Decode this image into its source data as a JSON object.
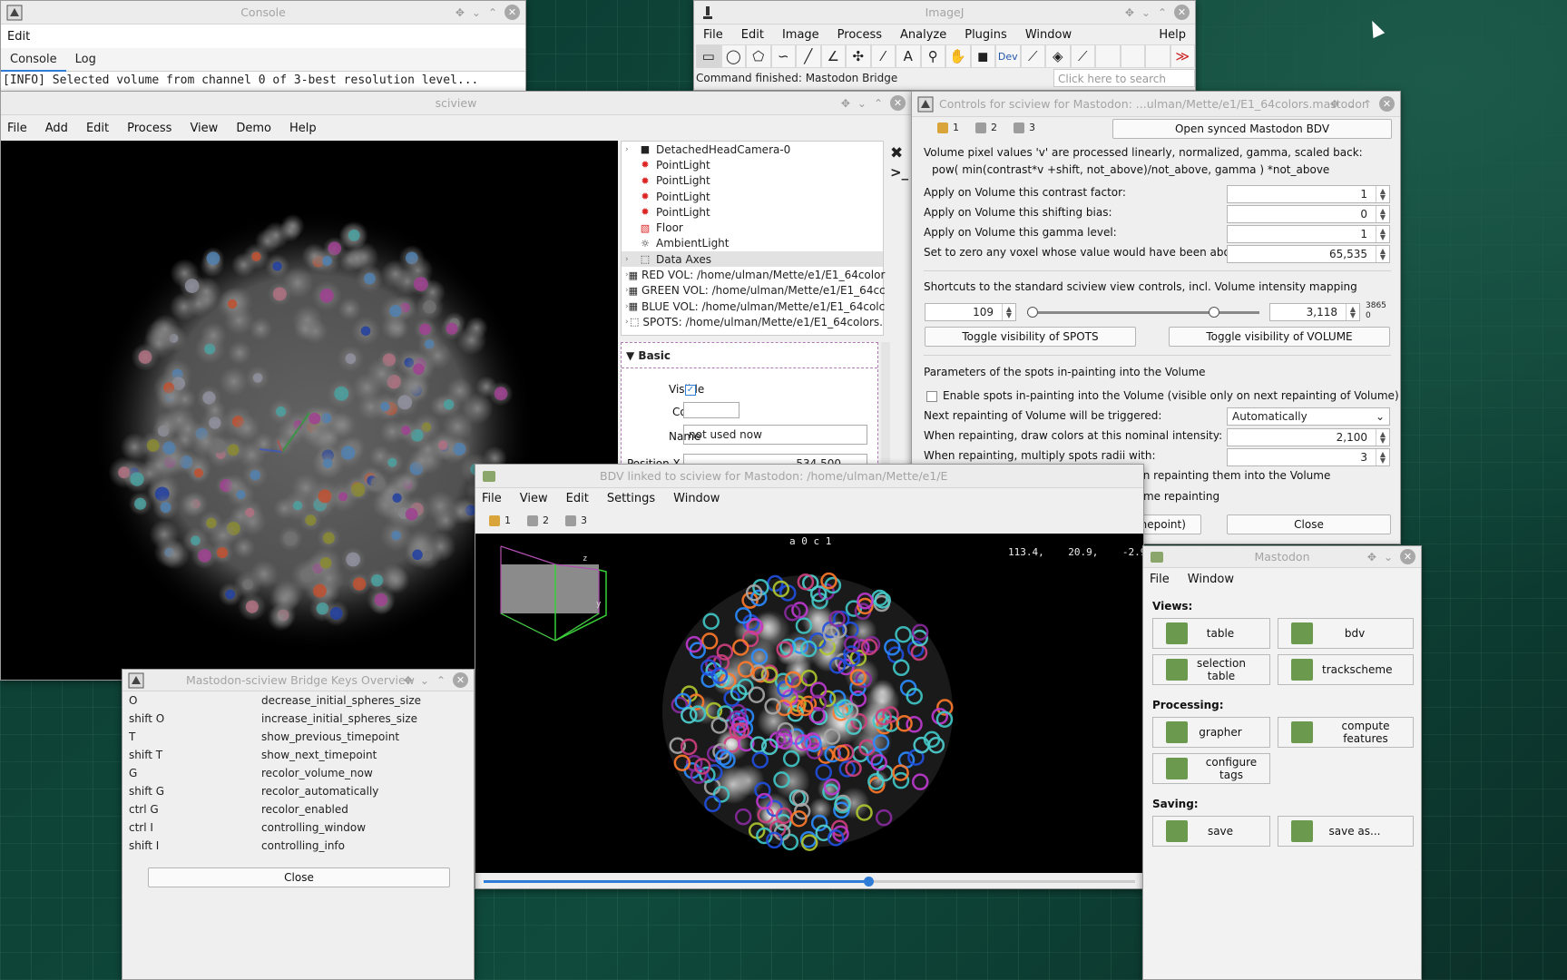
{
  "console": {
    "title": "Console",
    "menu": [
      "Edit"
    ],
    "tabs": [
      "Console",
      "Log"
    ],
    "line": "[INFO] Selected volume from channel 0 of 3-best resolution level..."
  },
  "imagej": {
    "title": "ImageJ",
    "menu": [
      "File",
      "Edit",
      "Image",
      "Process",
      "Analyze",
      "Plugins",
      "Window",
      "Help"
    ],
    "tools": [
      "rectangle-tool-icon",
      "oval-tool-icon",
      "polygon-tool-icon",
      "freehand-tool-icon",
      "line-tool-icon",
      "angle-tool-icon",
      "multipoint-tool-icon",
      "wand-tool-icon",
      "text-tool-icon",
      "magnifier-tool-icon",
      "hand-tool-icon",
      "color-picker-icon",
      "dev-tool-icon",
      "paintbrush-tool-icon",
      "flood-fill-tool-icon",
      "pipette-tool-icon",
      "blank-tool-1",
      "blank-tool-2",
      "blank-tool-3",
      "more-tools-icon"
    ],
    "dev_label": "Dev",
    "status": "Command finished: Mastodon Bridge",
    "search_placeholder": "Click here to search"
  },
  "sciview": {
    "title": "sciview",
    "menu": [
      "File",
      "Add",
      "Edit",
      "Process",
      "View",
      "Demo",
      "Help"
    ],
    "tree": [
      {
        "label": "DetachedHeadCamera-0",
        "icon": "camera-icon",
        "arrow": true
      },
      {
        "label": "PointLight",
        "icon": "point-light-icon",
        "arrow": false
      },
      {
        "label": "PointLight",
        "icon": "point-light-icon",
        "arrow": false
      },
      {
        "label": "PointLight",
        "icon": "point-light-icon",
        "arrow": false
      },
      {
        "label": "PointLight",
        "icon": "point-light-icon",
        "arrow": false
      },
      {
        "label": "Floor",
        "icon": "floor-icon",
        "arrow": false
      },
      {
        "label": "AmbientLight",
        "icon": "ambient-light-icon",
        "arrow": false
      },
      {
        "label": "Data Axes",
        "icon": "axes-icon",
        "arrow": true
      },
      {
        "label": "RED VOL: /home/ulman/Mette/e1/E1_64color",
        "icon": "volume-icon",
        "arrow": true
      },
      {
        "label": "GREEN VOL: /home/ulman/Mette/e1/E1_64cc",
        "icon": "volume-icon",
        "arrow": true
      },
      {
        "label": "BLUE VOL: /home/ulman/Mette/e1/E1_64colc",
        "icon": "volume-icon",
        "arrow": true
      },
      {
        "label": "SPOTS: /home/ulman/Mette/e1/E1_64colors.",
        "icon": "spots-icon",
        "arrow": true
      }
    ],
    "basic_header": "Basic",
    "visible_label": "Visible",
    "color_label": "Color",
    "name_label": "Name",
    "name_value": "not used now",
    "position_label": "Position X",
    "position_value": "534.500"
  },
  "controls": {
    "title": "Controls for sciview for Mastodon: ...ulman/Mette/e1/E1_64colors.mastodon",
    "locks": [
      "1",
      "2",
      "3"
    ],
    "open_bdv": "Open synced Mastodon BDV",
    "desc1": "Volume pixel values 'v' are processed linearly, normalized, gamma, scaled back:",
    "desc2": "pow( min(contrast*v +shift, not_above)/not_above, gamma ) *not_above",
    "contrast_label": "Apply on Volume this contrast factor:",
    "contrast_value": "1",
    "shift_label": "Apply on Volume this shifting bias:",
    "shift_value": "0",
    "gamma_label": "Apply on Volume this gamma level:",
    "gamma_value": "1",
    "above_label": "Set to zero any voxel whose value would have been above:",
    "above_value": "65,535",
    "shortcuts_label": "Shortcuts to the standard sciview view controls, incl. Volume intensity mapping",
    "range_min": "109",
    "range_max": "3,118",
    "range_hi": "3865",
    "range_lo": "0",
    "toggle_spots": "Toggle visibility of SPOTS",
    "toggle_volume": "Toggle visibility of VOLUME",
    "params_label": "Parameters of the spots in-painting into the Volume",
    "enable_inpaint": "Enable spots in-painting into the Volume (visible only on next repainting of Volume)",
    "trigger_label": "Next repainting of Volume will be triggered:",
    "trigger_value": "Automatically",
    "intensity_label": "When repainting, draw colors at this nominal intensity:",
    "intensity_value": "2,100",
    "radii_label": "When repainting, multiply spots radii with:",
    "radii_value": "3",
    "enhance_label": "Enable enhancing of spot colors when repainting them into the Volume",
    "verbose_label": "Verbose/debug reporting during Volume repainting",
    "repaint_button": "Repaint now (the recently painted timepoint)",
    "close_button": "Close"
  },
  "bdv": {
    "title": "BDV linked to sciview for Mastodon: /home/ulman/Mette/e1/E",
    "menu": [
      "File",
      "View",
      "Edit",
      "Settings",
      "Window"
    ],
    "locks": [
      "1",
      "2",
      "3"
    ],
    "source_label": "a 0 c 1",
    "coords": "113.4,    20.9,    -2.9",
    "slider": 0.59
  },
  "keys": {
    "title": "Mastodon-sciview Bridge Keys Overview",
    "rows": [
      [
        "O",
        "decrease_initial_spheres_size"
      ],
      [
        "shift O",
        "increase_initial_spheres_size"
      ],
      [
        "T",
        "show_previous_timepoint"
      ],
      [
        "shift T",
        "show_next_timepoint"
      ],
      [
        "G",
        "recolor_volume_now"
      ],
      [
        "shift G",
        "recolor_automatically"
      ],
      [
        "ctrl G",
        "recolor_enabled"
      ],
      [
        "ctrl I",
        "controlling_window"
      ],
      [
        "shift I",
        "controlling_info"
      ]
    ],
    "close": "Close"
  },
  "mastodon": {
    "title": "Mastodon",
    "menu": [
      "File",
      "Window"
    ],
    "views": "Views:",
    "processing": "Processing:",
    "saving": "Saving:",
    "b_table": "table",
    "b_bdv": "bdv",
    "b_seltable": "selection table",
    "b_trackscheme": "trackscheme",
    "b_grapher": "grapher",
    "b_compute": "compute features",
    "b_tags": "configure tags",
    "b_save": "save",
    "b_saveas": "save as..."
  }
}
